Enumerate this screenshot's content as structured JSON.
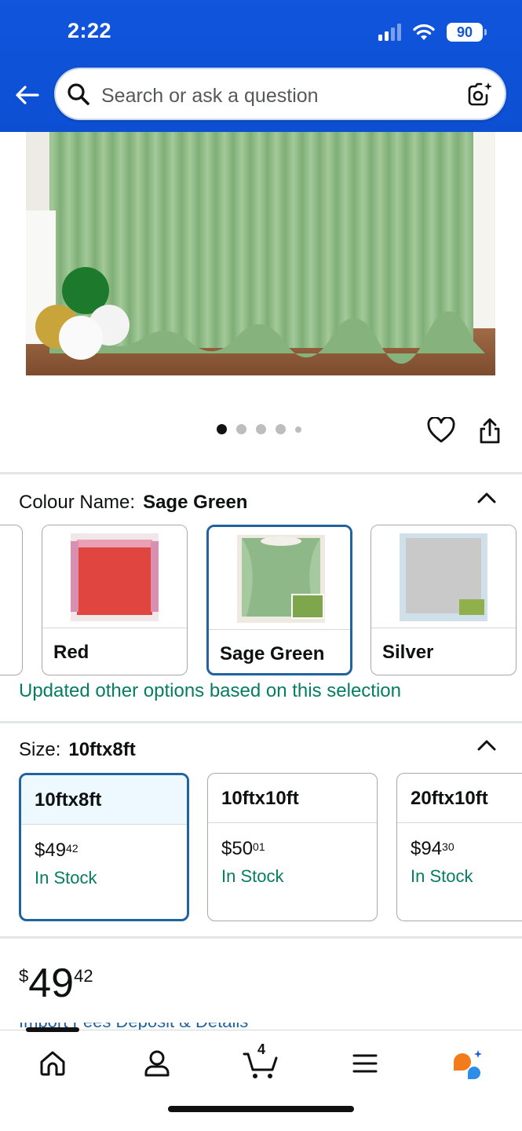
{
  "status_bar": {
    "time": "2:22",
    "battery": "90"
  },
  "search": {
    "placeholder": "Search or ask a question"
  },
  "colour": {
    "label": "Colour Name:",
    "selected": "Sage Green",
    "options": [
      {
        "name": "Red",
        "color": "#e0463f"
      },
      {
        "name": "Sage Green",
        "color": "#8fb889"
      },
      {
        "name": "Silver",
        "color": "#c9c9c9"
      }
    ],
    "note": "Updated other options based on this selection"
  },
  "size": {
    "label": "Size:",
    "selected": "10ftx8ft",
    "options": [
      {
        "name": "10ftx8ft",
        "price_whole": "$49",
        "price_frac": "42",
        "stock": "In Stock"
      },
      {
        "name": "10ftx10ft",
        "price_whole": "$50",
        "price_frac": "01",
        "stock": "In Stock"
      },
      {
        "name": "20ftx10ft",
        "price_whole": "$94",
        "price_frac": "30",
        "stock": "In Stock"
      }
    ]
  },
  "price": {
    "symbol": "$",
    "whole": "49",
    "fraction": "42"
  },
  "partial_link": "Import Fees Deposit & Details",
  "nav": {
    "cart_count": "4"
  },
  "colors": {
    "header": "#0f56d9",
    "selected_border": "#2162a1",
    "in_stock": "#067d62"
  }
}
